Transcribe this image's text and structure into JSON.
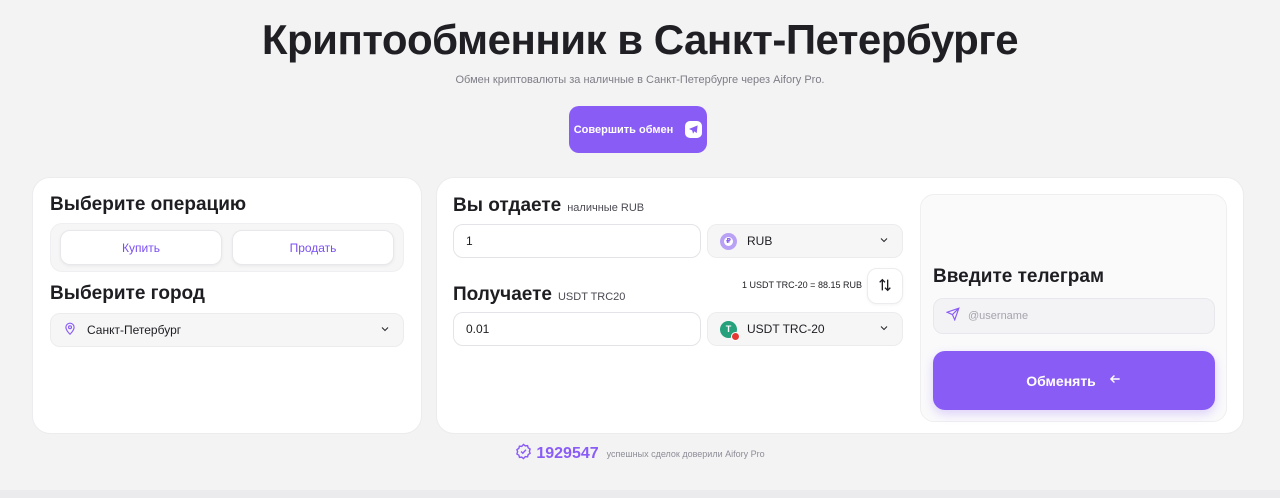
{
  "hero": {
    "title": "Криптообменник в Санкт-Петербурге",
    "subtitle": "Обмен криптовалюты за наличные в Санкт-Петербурге через Aifory Pro.",
    "cta_label": "Совершить обмен"
  },
  "operation": {
    "title": "Выберите операцию",
    "buy_label": "Купить",
    "sell_label": "Продать"
  },
  "city": {
    "title": "Выберите город",
    "selected": "Санкт-Петербург"
  },
  "give": {
    "title": "Вы отдаете",
    "tag": "наличные RUB",
    "amount": "1",
    "currency": "RUB"
  },
  "get": {
    "title": "Получаете",
    "tag": "USDT TRC20",
    "amount": "0.01",
    "currency": "USDT TRC-20"
  },
  "rate": "1 USDT TRC-20 = 88.15 RUB",
  "telegram": {
    "title": "Введите телеграм",
    "placeholder": "@username",
    "submit_label": "Обменять"
  },
  "trust": {
    "count": "1929547",
    "note": "успешных сделок доверили Aifory Pro"
  },
  "colors": {
    "accent": "#8a5cf6",
    "usdt": "#26a17b"
  },
  "icons": [
    "telegram-plane-icon",
    "location-pin-icon",
    "chevron-down-icon",
    "rub-coin-icon",
    "usdt-coin-icon",
    "swap-arrows-icon",
    "send-icon",
    "arrow-left-icon",
    "verified-badge-icon"
  ]
}
